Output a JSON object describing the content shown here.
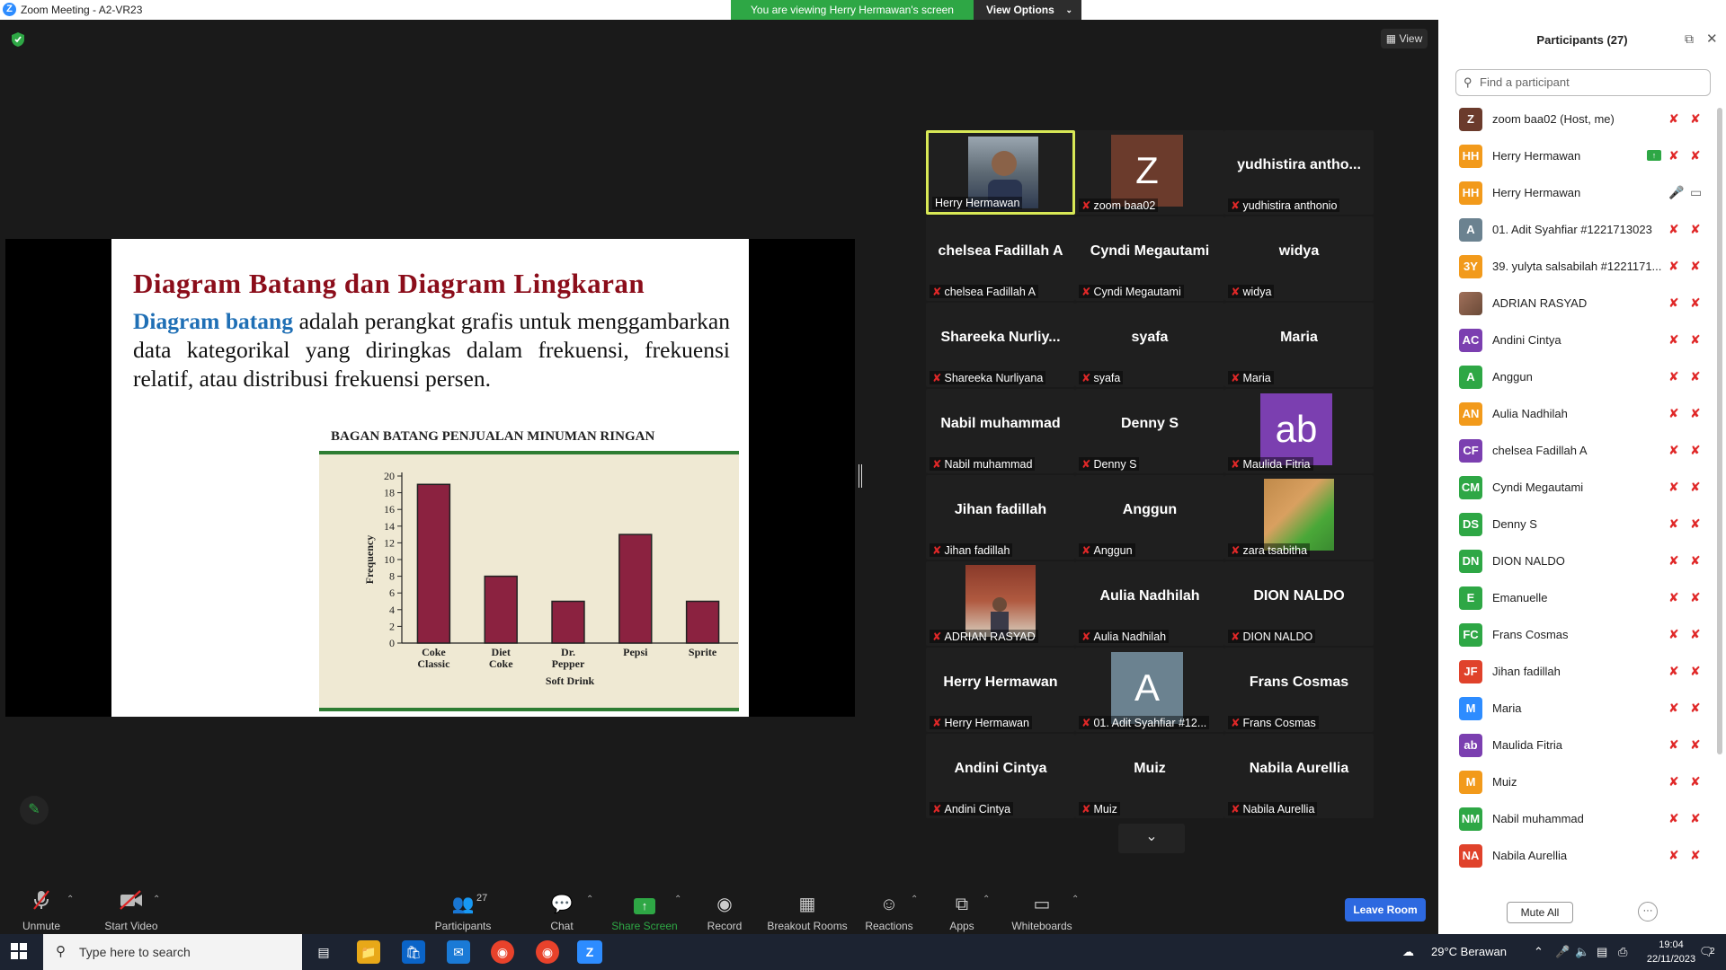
{
  "window": {
    "title": "Zoom Meeting - A2-VR23"
  },
  "banner": {
    "text": "You are viewing Herry Hermawan's screen",
    "view_options": "View Options"
  },
  "view_label": "View",
  "slide": {
    "heading": "Diagram Batang dan Diagram Lingkaran",
    "para_lead": "Diagram batang",
    "para_rest": " adalah perangkat grafis untuk menggambarkan data kategorikal yang diringkas dalam frekuensi, frekuensi relatif, atau distribusi frekuensi persen."
  },
  "chart_data": {
    "type": "bar",
    "title": "BAGAN BATANG PENJUALAN MINUMAN RINGAN",
    "categories": [
      "Coke Classic",
      "Diet Coke",
      "Dr. Pepper",
      "Pepsi",
      "Sprite"
    ],
    "category_lines": [
      [
        "Coke",
        "Classic"
      ],
      [
        "Diet",
        "Coke"
      ],
      [
        "Dr.",
        "Pepper"
      ],
      [
        "Pepsi"
      ],
      [
        "Sprite"
      ]
    ],
    "values": [
      19,
      8,
      5,
      13,
      5
    ],
    "xlabel": "Soft Drink",
    "ylabel": "Frequency",
    "ylim": [
      0,
      20
    ],
    "yticks": [
      0,
      2,
      4,
      6,
      8,
      10,
      12,
      14,
      16,
      18,
      20
    ],
    "bar_color": "#8b2240",
    "grid": false
  },
  "gallery": [
    {
      "big": "",
      "label": "Herry Hermawan",
      "type": "video",
      "active": true,
      "mic_muted": false
    },
    {
      "big": "Z",
      "label": "zoom baa02",
      "type": "avatar",
      "av_color": "#6b3b2c",
      "mic_muted": true
    },
    {
      "big": "yudhistira antho...",
      "label": "yudhistira anthonio",
      "type": "name",
      "mic_muted": true
    },
    {
      "big": "chelsea Fadillah A",
      "label": "chelsea Fadillah A",
      "type": "name",
      "mic_muted": true
    },
    {
      "big": "Cyndi Megautami",
      "label": "Cyndi Megautami",
      "type": "name",
      "mic_muted": true
    },
    {
      "big": "widya",
      "label": "widya",
      "type": "name",
      "mic_muted": true
    },
    {
      "big": "Shareeka Nurliy...",
      "label": "Shareeka Nurliyana",
      "type": "name",
      "mic_muted": true
    },
    {
      "big": "syafa",
      "label": "syafa",
      "type": "name",
      "mic_muted": true
    },
    {
      "big": "Maria",
      "label": "Maria",
      "type": "name",
      "mic_muted": true
    },
    {
      "big": "Nabil muhammad",
      "label": "Nabil muhammad",
      "type": "name",
      "mic_muted": true
    },
    {
      "big": "Denny S",
      "label": "Denny S",
      "type": "name",
      "mic_muted": true
    },
    {
      "big": "ab",
      "label": "Maulida Fitria",
      "type": "avatar",
      "av_color": "#7b3fb0",
      "mic_muted": true
    },
    {
      "big": "Jihan fadillah",
      "label": "Jihan fadillah",
      "type": "name",
      "mic_muted": true
    },
    {
      "big": "Anggun",
      "label": "Anggun",
      "type": "name",
      "mic_muted": true
    },
    {
      "big": "",
      "label": "zara tsabitha",
      "type": "photo-cat",
      "mic_muted": true
    },
    {
      "big": "",
      "label": "ADRIAN RASYAD",
      "type": "photo-room",
      "mic_muted": true
    },
    {
      "big": "Aulia Nadhilah",
      "label": "Aulia Nadhilah",
      "type": "name",
      "mic_muted": true
    },
    {
      "big": "DION NALDO",
      "label": "DION NALDO",
      "type": "name",
      "mic_muted": true
    },
    {
      "big": "Herry Hermawan",
      "label": "Herry Hermawan",
      "type": "name",
      "mic_muted": true
    },
    {
      "big": "A",
      "label": "01. Adit Syahfiar #12...",
      "type": "avatar",
      "av_color": "#6b8290",
      "mic_muted": true
    },
    {
      "big": "Frans Cosmas",
      "label": "Frans Cosmas",
      "type": "name",
      "mic_muted": true
    },
    {
      "big": "Andini Cintya",
      "label": "Andini Cintya",
      "type": "name",
      "mic_muted": true
    },
    {
      "big": "Muiz",
      "label": "Muiz",
      "type": "name",
      "mic_muted": true
    },
    {
      "big": "Nabila Aurellia",
      "label": "Nabila Aurellia",
      "type": "name",
      "mic_muted": true
    }
  ],
  "toolbar": {
    "unmute": "Unmute",
    "start_video": "Start Video",
    "participants": "Participants",
    "participants_count": "27",
    "chat": "Chat",
    "share_screen": "Share Screen",
    "record": "Record",
    "breakout": "Breakout Rooms",
    "reactions": "Reactions",
    "apps": "Apps",
    "whiteboards": "Whiteboards",
    "leave": "Leave Room"
  },
  "panel": {
    "title": "Participants (27)",
    "search_placeholder": "Find a participant",
    "mute_all": "Mute All",
    "more": "···",
    "participants": [
      {
        "initials": "Z",
        "name": "zoom baa02 (Host, me)",
        "color": "#6b3b2c"
      },
      {
        "initials": "HH",
        "name": "Herry Hermawan",
        "color": "#f29a1b",
        "sharing": true
      },
      {
        "initials": "HH",
        "name": "Herry Hermawan",
        "color": "#f29a1b",
        "active": true
      },
      {
        "initials": "A",
        "name": "01. Adit Syahfiar #1221713023",
        "color": "#6b8290"
      },
      {
        "initials": "3Y",
        "name": "39. yulyta salsabilah #1221171...",
        "color": "#f29a1b"
      },
      {
        "initials": "",
        "name": "ADRIAN RASYAD",
        "color": "#8a5a44",
        "photo": true
      },
      {
        "initials": "AC",
        "name": "Andini Cintya",
        "color": "#7b3fb0"
      },
      {
        "initials": "A",
        "name": "Anggun",
        "color": "#2ea745"
      },
      {
        "initials": "AN",
        "name": "Aulia Nadhilah",
        "color": "#f29a1b"
      },
      {
        "initials": "CF",
        "name": "chelsea Fadillah A",
        "color": "#7b3fb0"
      },
      {
        "initials": "CM",
        "name": "Cyndi Megautami",
        "color": "#2ea745"
      },
      {
        "initials": "DS",
        "name": "Denny S",
        "color": "#2ea745"
      },
      {
        "initials": "DN",
        "name": "DION NALDO",
        "color": "#2ea745"
      },
      {
        "initials": "E",
        "name": "Emanuelle",
        "color": "#2ea745"
      },
      {
        "initials": "FC",
        "name": "Frans Cosmas",
        "color": "#2ea745"
      },
      {
        "initials": "JF",
        "name": "Jihan fadillah",
        "color": "#e0422b"
      },
      {
        "initials": "M",
        "name": "Maria",
        "color": "#2d8cff"
      },
      {
        "initials": "ab",
        "name": "Maulida Fitria",
        "color": "#7b3fb0"
      },
      {
        "initials": "M",
        "name": "Muiz",
        "color": "#f29a1b"
      },
      {
        "initials": "NM",
        "name": "Nabil muhammad",
        "color": "#2ea745"
      },
      {
        "initials": "NA",
        "name": "Nabila Aurellia",
        "color": "#e0422b"
      }
    ]
  },
  "taskbar": {
    "search_placeholder": "Type here to search",
    "weather": "29°C  Berawan",
    "time": "19:04",
    "date": "22/11/2023",
    "notif_count": "2"
  }
}
